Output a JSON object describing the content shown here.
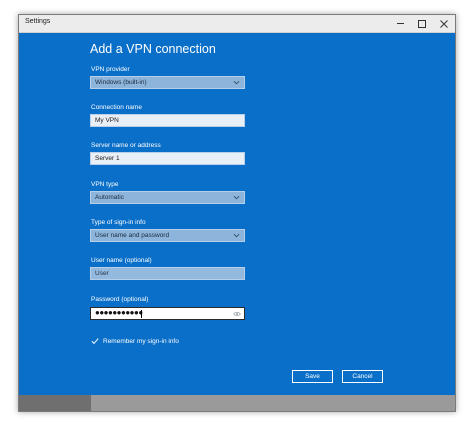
{
  "window": {
    "title": "Settings"
  },
  "page": {
    "heading": "Add a VPN connection"
  },
  "fields": {
    "vpn_provider": {
      "label": "VPN provider",
      "value": "Windows (built-in)"
    },
    "connection_name": {
      "label": "Connection name",
      "value": "My VPN"
    },
    "server": {
      "label": "Server name or address",
      "value": "Server 1"
    },
    "vpn_type": {
      "label": "VPN type",
      "value": "Automatic"
    },
    "sign_in_type": {
      "label": "Type of sign-in info",
      "value": "User name and password"
    },
    "user_name": {
      "label": "User name (optional)",
      "value": "User"
    },
    "password": {
      "label": "Password (optional)",
      "value": "●●●●●●●●●●●"
    }
  },
  "remember": {
    "label": "Remember my sign-in info",
    "checked": true
  },
  "buttons": {
    "save": "Save",
    "cancel": "Cancel"
  },
  "colors": {
    "background": "#0a6fc8",
    "text": "#ffffff",
    "select_fill": "#8db4da"
  },
  "icons": {
    "minimize": "minimize-icon",
    "maximize": "maximize-icon",
    "close": "close-icon",
    "dropdown": "chevron-down-icon",
    "reveal": "eye-icon",
    "check": "checkmark-icon"
  }
}
